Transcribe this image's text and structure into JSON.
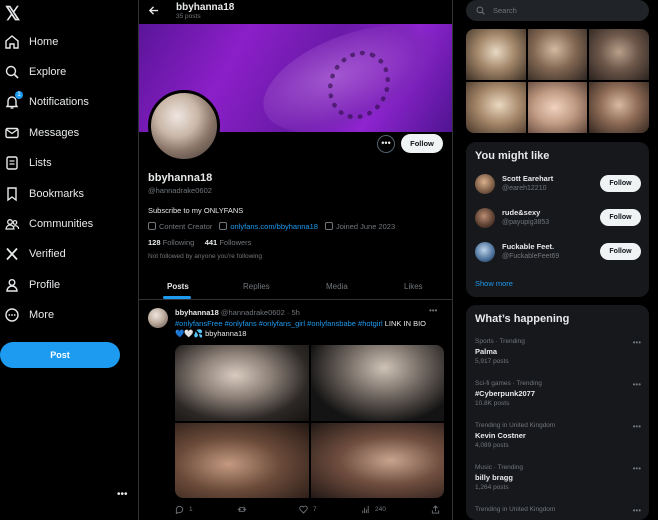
{
  "nav": {
    "items": [
      {
        "label": "Home",
        "icon": "home-icon"
      },
      {
        "label": "Explore",
        "icon": "search-icon"
      },
      {
        "label": "Notifications",
        "icon": "bell-icon",
        "badge": "1"
      },
      {
        "label": "Messages",
        "icon": "envelope-icon"
      },
      {
        "label": "Lists",
        "icon": "list-icon"
      },
      {
        "label": "Bookmarks",
        "icon": "bookmark-icon"
      },
      {
        "label": "Communities",
        "icon": "people-icon"
      },
      {
        "label": "Verified",
        "icon": "x-logo-icon"
      },
      {
        "label": "Profile",
        "icon": "person-icon"
      },
      {
        "label": "More",
        "icon": "more-circle-icon"
      }
    ],
    "post_label": "Post",
    "more_dots": "•••"
  },
  "topbar": {
    "name": "bbyhanna18",
    "posts": "35 posts"
  },
  "profile": {
    "name": "bbyhanna18",
    "handle": "@hannadrake0602",
    "bio": "Subscribe to my ONLYFANS",
    "category": "Content Creator",
    "link": "onlyfans.com/bbyhanna18",
    "joined": "Joined June 2023",
    "following_count": "128",
    "following_label": "Following",
    "followers_count": "441",
    "followers_label": "Followers",
    "not_followed": "Not followed by anyone you're following",
    "follow_label": "Follow",
    "more_label": "•••"
  },
  "tabs": [
    "Posts",
    "Replies",
    "Media",
    "Likes"
  ],
  "tweet": {
    "name": "bbyhanna18",
    "handle_time": "@hannadrake0602 · 5h",
    "text_tags": "#onlyfansFree #onlyfans #onlyfans_girl #onlyfansbabe #hotgirl",
    "text_rest": " LINK IN BIO 💙🤍💦 bbyhanna18",
    "replies": "1",
    "retweets": "",
    "likes": "7",
    "views": "240"
  },
  "right": {
    "search_placeholder": "Search",
    "you_might_like": "You might like",
    "suggestions": [
      {
        "name": "Scott Earehart",
        "handle": "@eareh12210",
        "follow": "Follow"
      },
      {
        "name": "rude&sexy",
        "handle": "@payupig3853",
        "follow": "Follow"
      },
      {
        "name": "Fuckable Feet.",
        "handle": "@FuckableFeet69",
        "follow": "Follow"
      }
    ],
    "show_more": "Show more",
    "whats_happening": "What’s happening",
    "trends": [
      {
        "context": "Sports · Trending",
        "title": "Palma",
        "count": "5,917 posts"
      },
      {
        "context": "Sci-fi games · Trending",
        "title": "#Cyberpunk2077",
        "count": "10.8K posts"
      },
      {
        "context": "Trending in United Kingdom",
        "title": "Kevin Costner",
        "count": "4,089 posts"
      },
      {
        "context": "Music · Trending",
        "title": "billy bragg",
        "count": "1,264 posts"
      },
      {
        "context": "Trending in United Kingdom",
        "title": "",
        "count": ""
      }
    ]
  },
  "colors": {
    "accent": "#1d9bf0",
    "background": "#000000",
    "panel": "#16181c",
    "muted": "#71767b",
    "banner": "#8b1fc8"
  }
}
